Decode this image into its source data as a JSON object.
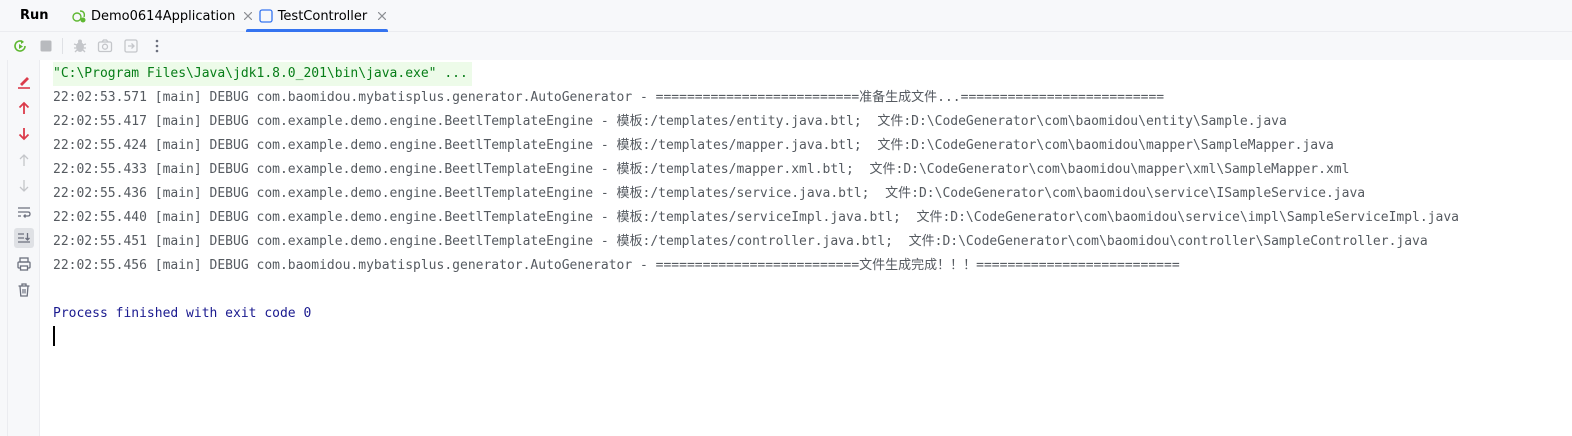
{
  "run_label": "Run",
  "tabs": [
    {
      "label": "Demo0614Application",
      "icon": "spring-boot-icon",
      "active": false
    },
    {
      "label": "TestController",
      "icon": "java-class-icon",
      "active": true
    }
  ],
  "toolbar": {
    "icons": [
      "rerun-icon",
      "stop-icon",
      "debug-icon",
      "camera-icon",
      "exit-icon",
      "more-options-icon"
    ]
  },
  "gutter": {
    "icons": [
      "clear-console-icon",
      "scroll-up-icon",
      "scroll-down-icon",
      "previous-occurrence-icon",
      "next-occurrence-icon",
      "soft-wrap-icon",
      "scroll-to-end-icon",
      "print-icon",
      "trash-icon"
    ]
  },
  "console": {
    "command": "\"C:\\Program Files\\Java\\jdk1.8.0_201\\bin\\java.exe\" ...",
    "lines": [
      "22:02:53.571 [main] DEBUG com.baomidou.mybatisplus.generator.AutoGenerator - ==========================准备生成文件...==========================",
      "22:02:55.417 [main] DEBUG com.example.demo.engine.BeetlTemplateEngine - 模板:/templates/entity.java.btl;  文件:D:\\CodeGenerator\\com\\baomidou\\entity\\Sample.java",
      "22:02:55.424 [main] DEBUG com.example.demo.engine.BeetlTemplateEngine - 模板:/templates/mapper.java.btl;  文件:D:\\CodeGenerator\\com\\baomidou\\mapper\\SampleMapper.java",
      "22:02:55.433 [main] DEBUG com.example.demo.engine.BeetlTemplateEngine - 模板:/templates/mapper.xml.btl;  文件:D:\\CodeGenerator\\com\\baomidou\\mapper\\xml\\SampleMapper.xml",
      "22:02:55.436 [main] DEBUG com.example.demo.engine.BeetlTemplateEngine - 模板:/templates/service.java.btl;  文件:D:\\CodeGenerator\\com\\baomidou\\service\\ISampleService.java",
      "22:02:55.440 [main] DEBUG com.example.demo.engine.BeetlTemplateEngine - 模板:/templates/serviceImpl.java.btl;  文件:D:\\CodeGenerator\\com\\baomidou\\service\\impl\\SampleServiceImpl.java",
      "22:02:55.451 [main] DEBUG com.example.demo.engine.BeetlTemplateEngine - 模板:/templates/controller.java.btl;  文件:D:\\CodeGenerator\\com\\baomidou\\controller\\SampleController.java",
      "22:02:55.456 [main] DEBUG com.baomidou.mybatisplus.generator.AutoGenerator - ==========================文件生成完成！！！=========================="
    ],
    "exit_message": "Process finished with exit code 0"
  },
  "colors": {
    "accent": "#3574f0",
    "command_text": "#067d17",
    "command_bg": "#edfbe9",
    "log_text": "#555a60",
    "exit_text": "#1a1a8f",
    "stop_red": "#db3b4b"
  }
}
